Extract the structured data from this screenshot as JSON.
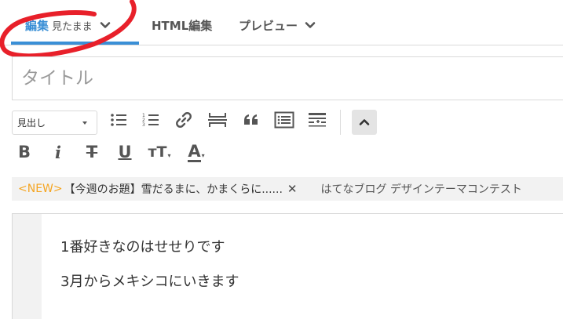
{
  "tabs": [
    {
      "label": "編集",
      "sublabel": "見たまま",
      "active": true
    },
    {
      "label": "HTML編集",
      "active": false
    },
    {
      "label": "プレビュー",
      "active": false
    }
  ],
  "accent_color": "#3a8fd6",
  "title_placeholder": "タイトル",
  "toolbar": {
    "format_value": "見出し",
    "buttons": [
      "unordered-list-icon",
      "ordered-list-icon",
      "link-icon",
      "page-break-icon",
      "quote-icon",
      "table-of-contents-icon",
      "summary-icon",
      "collapse-toolbar-icon"
    ],
    "format_buttons": [
      {
        "label": "B",
        "name": "bold"
      },
      {
        "label": "i",
        "name": "italic"
      },
      {
        "label": "T",
        "name": "strikethrough"
      },
      {
        "label": "U",
        "name": "underline"
      },
      {
        "label": "тT",
        "name": "font-size"
      },
      {
        "label": "A",
        "name": "text-color"
      }
    ]
  },
  "notice": {
    "tag": "<NEW>",
    "message": "【今週のお題】雪だるまに、かまくらに......",
    "close": "✕",
    "message2": "はてなブログ デザインテーマコンテスト"
  },
  "editor": {
    "lines": [
      "1番好きなのはせせりです",
      "3月からメキシコにいきます"
    ]
  },
  "annotation_color": "#e8202a"
}
